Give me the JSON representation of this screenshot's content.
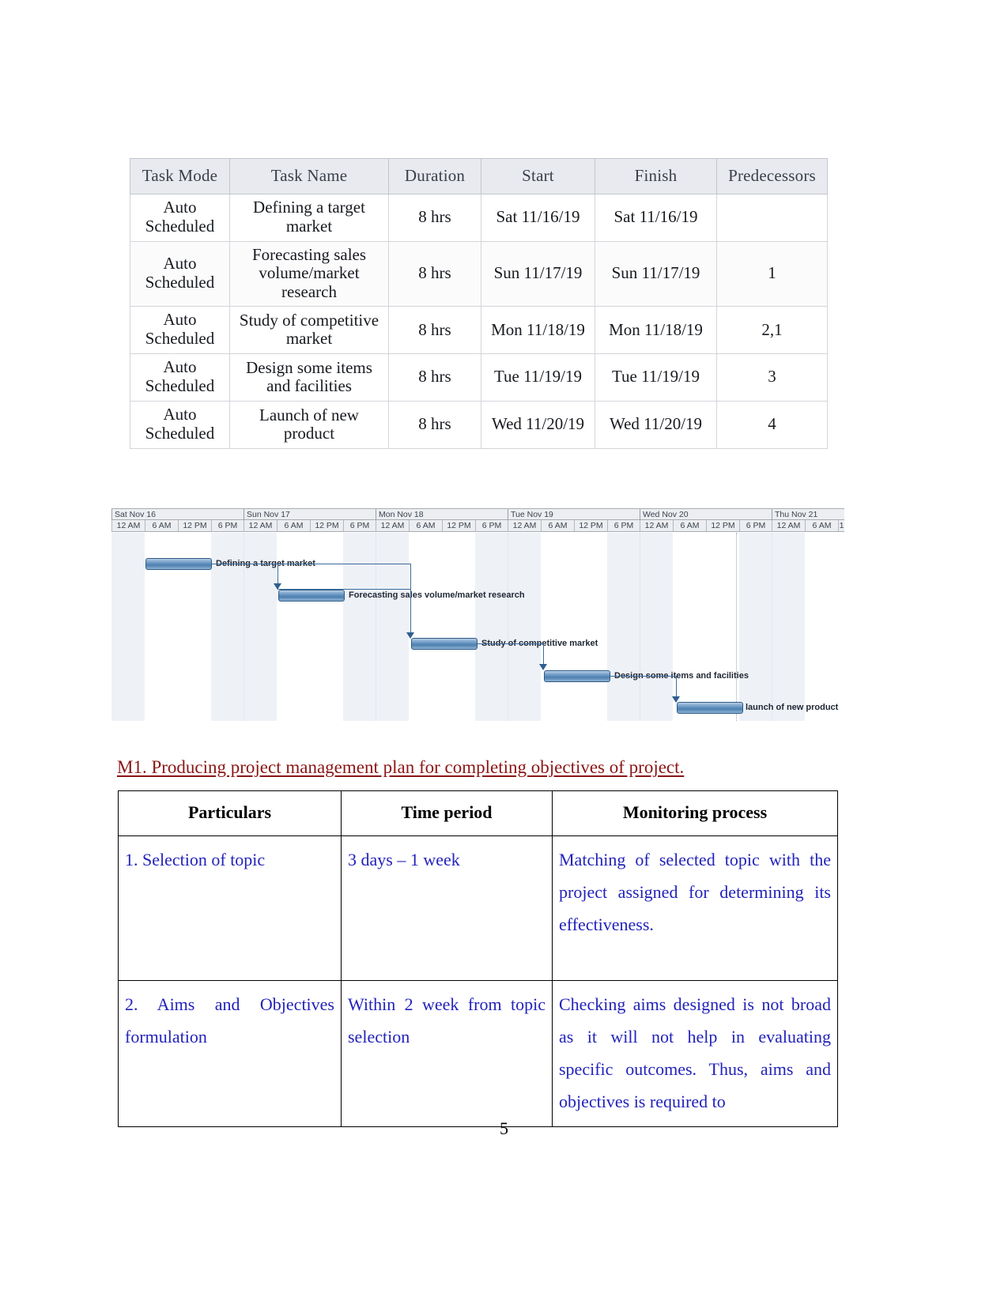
{
  "task_table": {
    "headers": [
      "Task Mode",
      "Task Name",
      "Duration",
      "Start",
      "Finish",
      "Predecessors"
    ],
    "rows": [
      {
        "mode": "Auto Scheduled",
        "name": "Defining a target market",
        "duration": "8 hrs",
        "start": "Sat 11/16/19",
        "finish": "Sat 11/16/19",
        "predecessors": ""
      },
      {
        "mode": "Auto Scheduled",
        "name": "Forecasting sales volume/market research",
        "duration": "8 hrs",
        "start": "Sun 11/17/19",
        "finish": "Sun 11/17/19",
        "predecessors": "1"
      },
      {
        "mode": "Auto Scheduled",
        "name": "Study of competitive market",
        "duration": "8 hrs",
        "start": "Mon 11/18/19",
        "finish": "Mon 11/18/19",
        "predecessors": "2,1"
      },
      {
        "mode": "Auto Scheduled",
        "name": "Design some items and facilities",
        "duration": "8 hrs",
        "start": "Tue 11/19/19",
        "finish": "Tue 11/19/19",
        "predecessors": "3"
      },
      {
        "mode": "Auto Scheduled",
        "name": "Launch of new product",
        "duration": "8 hrs",
        "start": "Wed 11/20/19",
        "finish": "Wed 11/20/19",
        "predecessors": "4"
      }
    ]
  },
  "gantt": {
    "days": [
      "Sat Nov 16",
      "Sun Nov 17",
      "Mon Nov 18",
      "Tue Nov 19",
      "Wed Nov 20",
      "Thu Nov 21"
    ],
    "hours": [
      "12 AM",
      "6 AM",
      "12 PM",
      "6 PM"
    ],
    "last_partial_hour": "1",
    "bars": [
      {
        "label": "Defining a target market",
        "start_day": "Sat Nov 16",
        "duration": "8 hrs"
      },
      {
        "label": "Forecasting sales volume/market research",
        "start_day": "Sun Nov 17",
        "duration": "8 hrs"
      },
      {
        "label": "Study of competitive market",
        "start_day": "Mon Nov 18",
        "duration": "8 hrs"
      },
      {
        "label": "Design some items and facilities",
        "start_day": "Tue Nov 19",
        "duration": "8 hrs"
      },
      {
        "label": "launch of new product",
        "start_day": "Wed Nov 20",
        "duration": "8 hrs"
      }
    ]
  },
  "heading": {
    "m1": "M1. Producing project management plan for completing objectives of project."
  },
  "plan_table": {
    "headers": [
      "Particulars",
      "Time period",
      "Monitoring process"
    ],
    "rows": [
      {
        "particulars": "1.  Selection of topic",
        "time_period": "3 days – 1 week",
        "monitoring": "Matching of selected topic with the project assigned for determining its effectiveness."
      },
      {
        "particulars": "2. Aims and Objectives formulation",
        "time_period": "Within 2 week from topic selection",
        "monitoring": "Checking aims designed is not broad as it will not help in evaluating specific outcomes. Thus, aims and objectives is required to"
      }
    ]
  },
  "footer": {
    "page_number": "5"
  },
  "colors": {
    "heading_red": "#8c1515",
    "body_blue": "#2222bb",
    "gantt_bar": "#5b8cbb",
    "gantt_header_bg": "#eceef1"
  }
}
